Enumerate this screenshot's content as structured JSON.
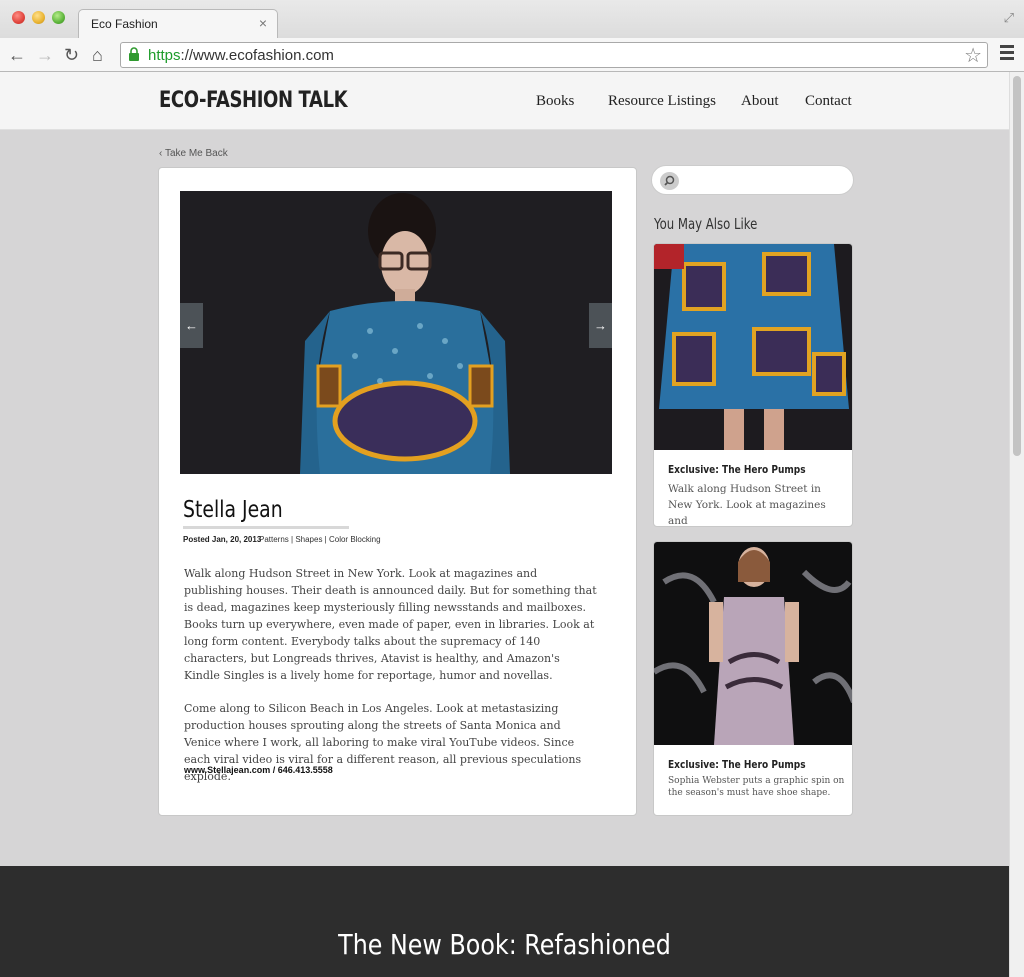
{
  "browser": {
    "tab_title": "Eco Fashion",
    "tab_close": "×",
    "url_scheme": "https",
    "url_rest": "://www.ecofashion.com"
  },
  "site": {
    "logo": "ECO-FASHION TALK",
    "nav": [
      "Books",
      "Resource Listings",
      "About",
      "Contact"
    ]
  },
  "back_link": "Take Me Back",
  "article": {
    "title": "Stella Jean",
    "posted_label": "Posted Jan, 20, 2013",
    "tags": "Patterns  |  Shapes  |  Color Blocking",
    "paragraphs": [
      "Walk along Hudson Street in New York. Look at magazines and publishing houses. Their death is announced daily. But for something that is dead, magazines keep mysteriously filling newsstands and mailboxes. Books turn up everywhere, even made of paper, even in libraries. Look at long form content. Everybody talks about the supremacy of 140 characters, but Longreads thrives, Atavist is healthy, and Amazon's Kindle Singles is a lively home for reportage, humor and novellas.",
      "Come along to Silicon Beach in Los Angeles. Look at metastasizing production houses sprouting along the streets of Santa Monica and Venice where I work, all laboring to make viral YouTube videos. Since each viral video is viral for a different reason, all previous speculations explode."
    ],
    "contact": "www.Stellajean.com  /  646.413.5558"
  },
  "sidebar": {
    "heading": "You May Also Like",
    "cards": [
      {
        "title": "Exclusive: The Hero Pumps",
        "text": "Walk along Hudson Street in New York. Look at magazines and"
      },
      {
        "title": "Exclusive: The Hero Pumps",
        "text": "Sophia Webster puts a graphic spin on the season's must have shoe shape."
      }
    ]
  },
  "footer": {
    "title": "The New Book: Refashioned"
  },
  "colors": {
    "accent_green": "#1e9c2b",
    "page_bg": "#d6d5d6",
    "footer_bg": "#2d2d2d"
  }
}
